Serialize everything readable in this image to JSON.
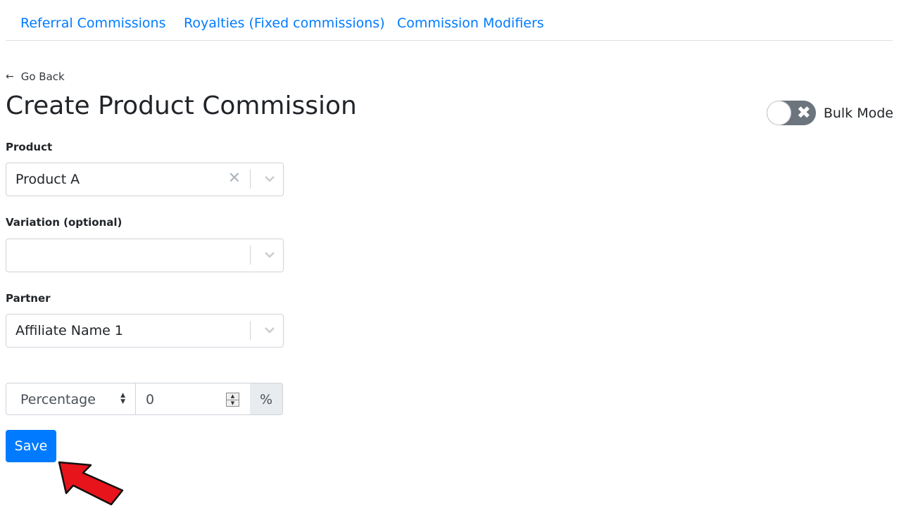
{
  "tabs": [
    {
      "label": "Referral Commissions"
    },
    {
      "label": "Royalties (Fixed commissions)"
    },
    {
      "label": "Commission Modifiers"
    }
  ],
  "back_label": "Go Back",
  "page_title": "Create Product Commission",
  "bulk_mode": {
    "label": "Bulk Mode",
    "enabled": false
  },
  "fields": {
    "product": {
      "label": "Product",
      "value": "Product A"
    },
    "variation": {
      "label": "Variation (optional)",
      "value": ""
    },
    "partner": {
      "label": "Partner",
      "value": "Affiliate Name 1"
    }
  },
  "commission": {
    "type": "Percentage",
    "amount": "0",
    "unit": "%"
  },
  "save_label": "Save",
  "colors": {
    "primary": "#007bff",
    "toggle_off": "#6c757d",
    "annotation_arrow": "#e8141b"
  },
  "icons": {
    "back": "arrow-left-icon",
    "clear": "close-icon",
    "dropdown": "chevron-down-icon"
  }
}
